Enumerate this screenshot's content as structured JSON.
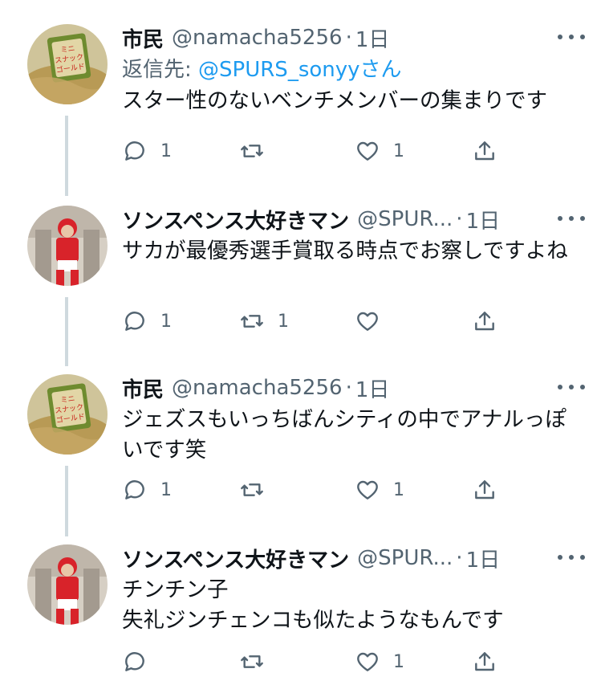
{
  "tweets": [
    {
      "name": "市民",
      "handle": "@namacha5256",
      "dot": "·",
      "time": "1日",
      "reply_prefix": "返信先:",
      "reply_handle": "@SPURS_sonyy",
      "reply_suffix": "さん",
      "body": "スター性のないベンチメンバーの集まりです",
      "replies": "1",
      "retweets": "",
      "likes": "1"
    },
    {
      "name": "ソンスペンス大好きマン",
      "handle": "@SPUR...",
      "dot": "·",
      "time": "1日",
      "body": "サカが最優秀選手賞取る時点でお察しですよね",
      "replies": "1",
      "retweets": "1",
      "likes": ""
    },
    {
      "name": "市民",
      "handle": "@namacha5256",
      "dot": "·",
      "time": "1日",
      "body": "ジェズスもいっちばんシティの中でアナルっぽいです笑",
      "replies": "1",
      "retweets": "",
      "likes": "1"
    },
    {
      "name": "ソンスペンス大好きマン",
      "handle": "@SPUR...",
      "dot": "·",
      "time": "1日",
      "body_line1": "チンチン子",
      "body_line2": "失礼ジンチェンコも似たようなもんです",
      "replies": "",
      "retweets": "",
      "likes": "1"
    }
  ],
  "avatars": {
    "tweet1": {
      "text": "ミニスナックゴールド",
      "colors": [
        "#b9a46a",
        "#7a8f3a",
        "#d33a2c"
      ]
    },
    "tweet2": {
      "colors": [
        "#c9c2b8",
        "#d8232a",
        "#ffffff"
      ]
    }
  },
  "colors": {
    "text": "#0f1419",
    "secondary": "#536471",
    "link": "#1d9bf0",
    "thread_line": "#cfd9de"
  }
}
